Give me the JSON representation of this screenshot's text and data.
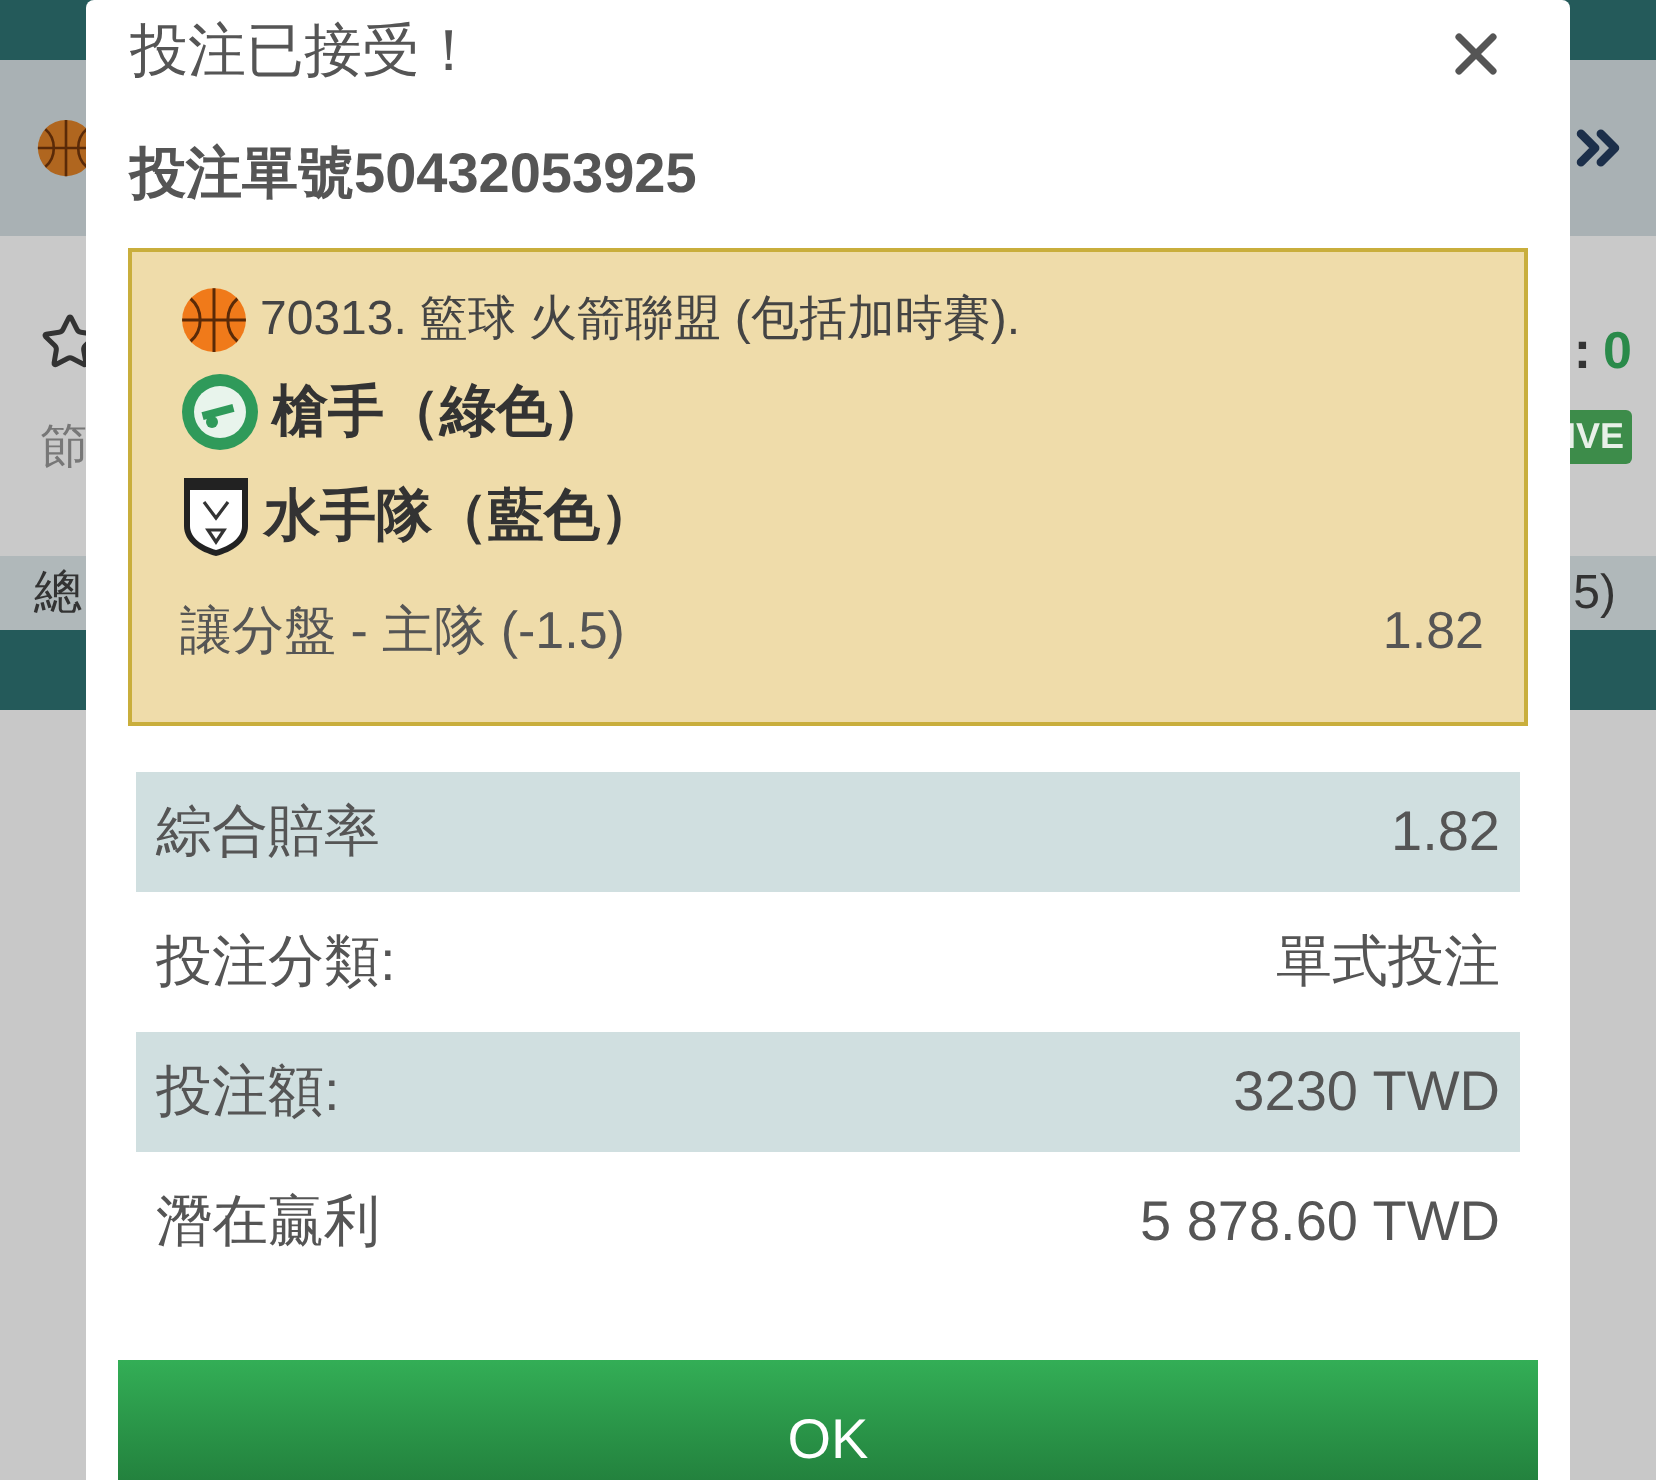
{
  "background": {
    "category_label": "節",
    "total_label": "總",
    "score_separator": ":",
    "score": "0",
    "live_badge": "IVE",
    "line_value": "5)"
  },
  "dialog": {
    "title": "投注已接受！",
    "bet_number": "投注單號50432053925",
    "selection": {
      "league": "70313. 籃球 火箭聯盟 (包括加時賽).",
      "teams": [
        {
          "name": "槍手（綠色）",
          "kind": "round"
        },
        {
          "name": "水手隊（藍色）",
          "kind": "shield"
        }
      ],
      "market": "讓分盤 - 主隊 (-1.5)",
      "odds": "1.82"
    },
    "summary": [
      {
        "label": "綜合賠率",
        "value": "1.82"
      },
      {
        "label": "投注分類:",
        "value": "單式投注"
      },
      {
        "label": "投注額:",
        "value": "3230 TWD"
      },
      {
        "label": "潛在贏利",
        "value": "5 878.60 TWD"
      }
    ],
    "ok_button": "OK"
  }
}
